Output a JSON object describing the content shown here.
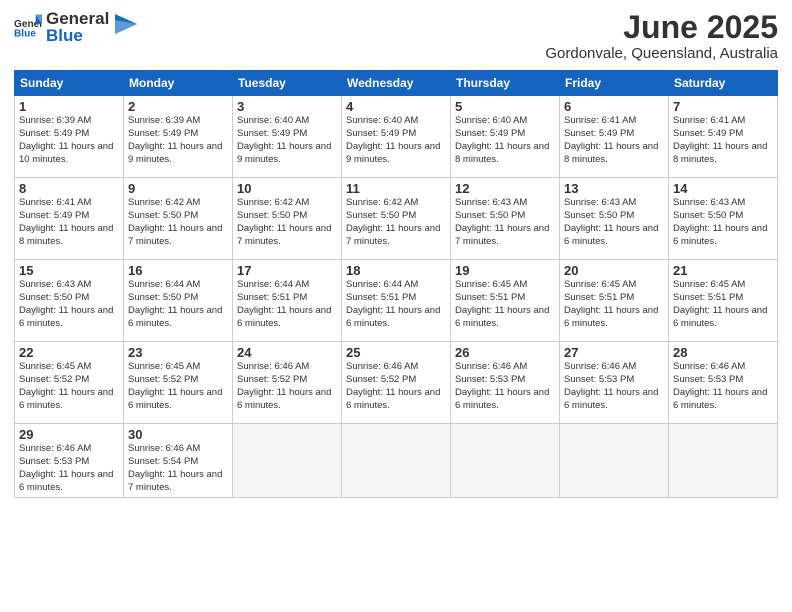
{
  "header": {
    "logo_general": "General",
    "logo_blue": "Blue",
    "title": "June 2025",
    "subtitle": "Gordonvale, Queensland, Australia"
  },
  "columns": [
    "Sunday",
    "Monday",
    "Tuesday",
    "Wednesday",
    "Thursday",
    "Friday",
    "Saturday"
  ],
  "weeks": [
    [
      {
        "day": "1",
        "sunrise": "Sunrise: 6:39 AM",
        "sunset": "Sunset: 5:49 PM",
        "daylight": "Daylight: 11 hours and 10 minutes."
      },
      {
        "day": "2",
        "sunrise": "Sunrise: 6:39 AM",
        "sunset": "Sunset: 5:49 PM",
        "daylight": "Daylight: 11 hours and 9 minutes."
      },
      {
        "day": "3",
        "sunrise": "Sunrise: 6:40 AM",
        "sunset": "Sunset: 5:49 PM",
        "daylight": "Daylight: 11 hours and 9 minutes."
      },
      {
        "day": "4",
        "sunrise": "Sunrise: 6:40 AM",
        "sunset": "Sunset: 5:49 PM",
        "daylight": "Daylight: 11 hours and 9 minutes."
      },
      {
        "day": "5",
        "sunrise": "Sunrise: 6:40 AM",
        "sunset": "Sunset: 5:49 PM",
        "daylight": "Daylight: 11 hours and 8 minutes."
      },
      {
        "day": "6",
        "sunrise": "Sunrise: 6:41 AM",
        "sunset": "Sunset: 5:49 PM",
        "daylight": "Daylight: 11 hours and 8 minutes."
      },
      {
        "day": "7",
        "sunrise": "Sunrise: 6:41 AM",
        "sunset": "Sunset: 5:49 PM",
        "daylight": "Daylight: 11 hours and 8 minutes."
      }
    ],
    [
      {
        "day": "8",
        "sunrise": "Sunrise: 6:41 AM",
        "sunset": "Sunset: 5:49 PM",
        "daylight": "Daylight: 11 hours and 8 minutes."
      },
      {
        "day": "9",
        "sunrise": "Sunrise: 6:42 AM",
        "sunset": "Sunset: 5:50 PM",
        "daylight": "Daylight: 11 hours and 7 minutes."
      },
      {
        "day": "10",
        "sunrise": "Sunrise: 6:42 AM",
        "sunset": "Sunset: 5:50 PM",
        "daylight": "Daylight: 11 hours and 7 minutes."
      },
      {
        "day": "11",
        "sunrise": "Sunrise: 6:42 AM",
        "sunset": "Sunset: 5:50 PM",
        "daylight": "Daylight: 11 hours and 7 minutes."
      },
      {
        "day": "12",
        "sunrise": "Sunrise: 6:43 AM",
        "sunset": "Sunset: 5:50 PM",
        "daylight": "Daylight: 11 hours and 7 minutes."
      },
      {
        "day": "13",
        "sunrise": "Sunrise: 6:43 AM",
        "sunset": "Sunset: 5:50 PM",
        "daylight": "Daylight: 11 hours and 6 minutes."
      },
      {
        "day": "14",
        "sunrise": "Sunrise: 6:43 AM",
        "sunset": "Sunset: 5:50 PM",
        "daylight": "Daylight: 11 hours and 6 minutes."
      }
    ],
    [
      {
        "day": "15",
        "sunrise": "Sunrise: 6:43 AM",
        "sunset": "Sunset: 5:50 PM",
        "daylight": "Daylight: 11 hours and 6 minutes."
      },
      {
        "day": "16",
        "sunrise": "Sunrise: 6:44 AM",
        "sunset": "Sunset: 5:50 PM",
        "daylight": "Daylight: 11 hours and 6 minutes."
      },
      {
        "day": "17",
        "sunrise": "Sunrise: 6:44 AM",
        "sunset": "Sunset: 5:51 PM",
        "daylight": "Daylight: 11 hours and 6 minutes."
      },
      {
        "day": "18",
        "sunrise": "Sunrise: 6:44 AM",
        "sunset": "Sunset: 5:51 PM",
        "daylight": "Daylight: 11 hours and 6 minutes."
      },
      {
        "day": "19",
        "sunrise": "Sunrise: 6:45 AM",
        "sunset": "Sunset: 5:51 PM",
        "daylight": "Daylight: 11 hours and 6 minutes."
      },
      {
        "day": "20",
        "sunrise": "Sunrise: 6:45 AM",
        "sunset": "Sunset: 5:51 PM",
        "daylight": "Daylight: 11 hours and 6 minutes."
      },
      {
        "day": "21",
        "sunrise": "Sunrise: 6:45 AM",
        "sunset": "Sunset: 5:51 PM",
        "daylight": "Daylight: 11 hours and 6 minutes."
      }
    ],
    [
      {
        "day": "22",
        "sunrise": "Sunrise: 6:45 AM",
        "sunset": "Sunset: 5:52 PM",
        "daylight": "Daylight: 11 hours and 6 minutes."
      },
      {
        "day": "23",
        "sunrise": "Sunrise: 6:45 AM",
        "sunset": "Sunset: 5:52 PM",
        "daylight": "Daylight: 11 hours and 6 minutes."
      },
      {
        "day": "24",
        "sunrise": "Sunrise: 6:46 AM",
        "sunset": "Sunset: 5:52 PM",
        "daylight": "Daylight: 11 hours and 6 minutes."
      },
      {
        "day": "25",
        "sunrise": "Sunrise: 6:46 AM",
        "sunset": "Sunset: 5:52 PM",
        "daylight": "Daylight: 11 hours and 6 minutes."
      },
      {
        "day": "26",
        "sunrise": "Sunrise: 6:46 AM",
        "sunset": "Sunset: 5:53 PM",
        "daylight": "Daylight: 11 hours and 6 minutes."
      },
      {
        "day": "27",
        "sunrise": "Sunrise: 6:46 AM",
        "sunset": "Sunset: 5:53 PM",
        "daylight": "Daylight: 11 hours and 6 minutes."
      },
      {
        "day": "28",
        "sunrise": "Sunrise: 6:46 AM",
        "sunset": "Sunset: 5:53 PM",
        "daylight": "Daylight: 11 hours and 6 minutes."
      }
    ],
    [
      {
        "day": "29",
        "sunrise": "Sunrise: 6:46 AM",
        "sunset": "Sunset: 5:53 PM",
        "daylight": "Daylight: 11 hours and 6 minutes."
      },
      {
        "day": "30",
        "sunrise": "Sunrise: 6:46 AM",
        "sunset": "Sunset: 5:54 PM",
        "daylight": "Daylight: 11 hours and 7 minutes."
      },
      null,
      null,
      null,
      null,
      null
    ]
  ]
}
